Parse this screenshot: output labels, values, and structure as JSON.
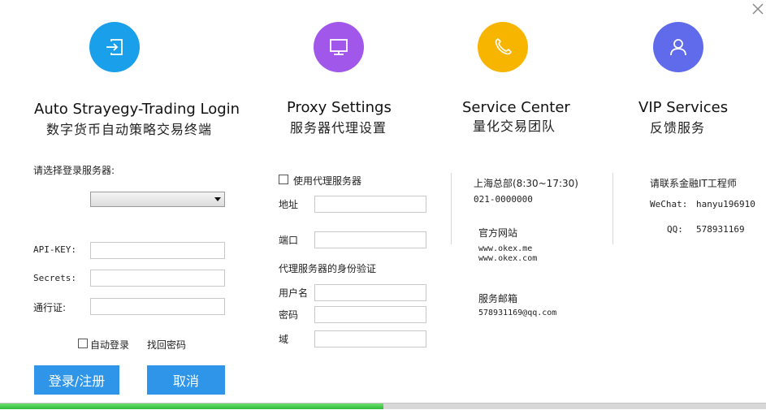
{
  "sections": {
    "login": {
      "title": "Auto Strayegy-Trading Login",
      "subtitle": "数字货币自动策略交易终端",
      "color": "#1aa0ea"
    },
    "proxy": {
      "title": "Proxy Settings",
      "subtitle": "服务器代理设置",
      "color": "#a157ea"
    },
    "service": {
      "title": "Service Center",
      "subtitle": "量化交易团队",
      "color": "#f7b500"
    },
    "vip": {
      "title": "VIP Services",
      "subtitle": "反馈服务",
      "color": "#5f6bea"
    }
  },
  "login": {
    "server_label": "请选择登录服务器:",
    "server_value": "",
    "apikey_label": "API-KEY:",
    "apikey_value": "",
    "secrets_label": "Secrets:",
    "secrets_value": "",
    "pass_label": "通行证:",
    "pass_value": "",
    "auto_login_label": "自动登录",
    "auto_login_checked": false,
    "find_password": "找回密码",
    "login_button": "登录/注册",
    "cancel_button": "取消"
  },
  "proxy": {
    "use_proxy_label": "使用代理服务器",
    "use_proxy_checked": false,
    "address_label": "地址",
    "address_value": "",
    "port_label": "端口",
    "port_value": "",
    "auth_label": "代理服务器的身份验证",
    "username_label": "用户名",
    "username_value": "",
    "password_label": "密码",
    "password_value": "",
    "domain_label": "域",
    "domain_value": ""
  },
  "service": {
    "hq_label": "上海总部(8:30~17:30)",
    "phone": "021-0000000",
    "website_label": "官方网站",
    "website1": "www.okex.me",
    "website2": "www.okex.com",
    "email_label": "服务邮箱",
    "email": "578931169@qq.com"
  },
  "vip": {
    "contact_label": "请联系金融IT工程师",
    "wechat_label": "WeChat:",
    "wechat_value": "hanyu196910",
    "qq_label": "QQ:",
    "qq_value": "578931169"
  },
  "icons": {
    "close": "close-icon",
    "login": "login-arrow-icon",
    "proxy": "monitor-icon",
    "service": "phone-icon",
    "vip": "user-icon"
  },
  "progress": {
    "value": 0.5
  }
}
